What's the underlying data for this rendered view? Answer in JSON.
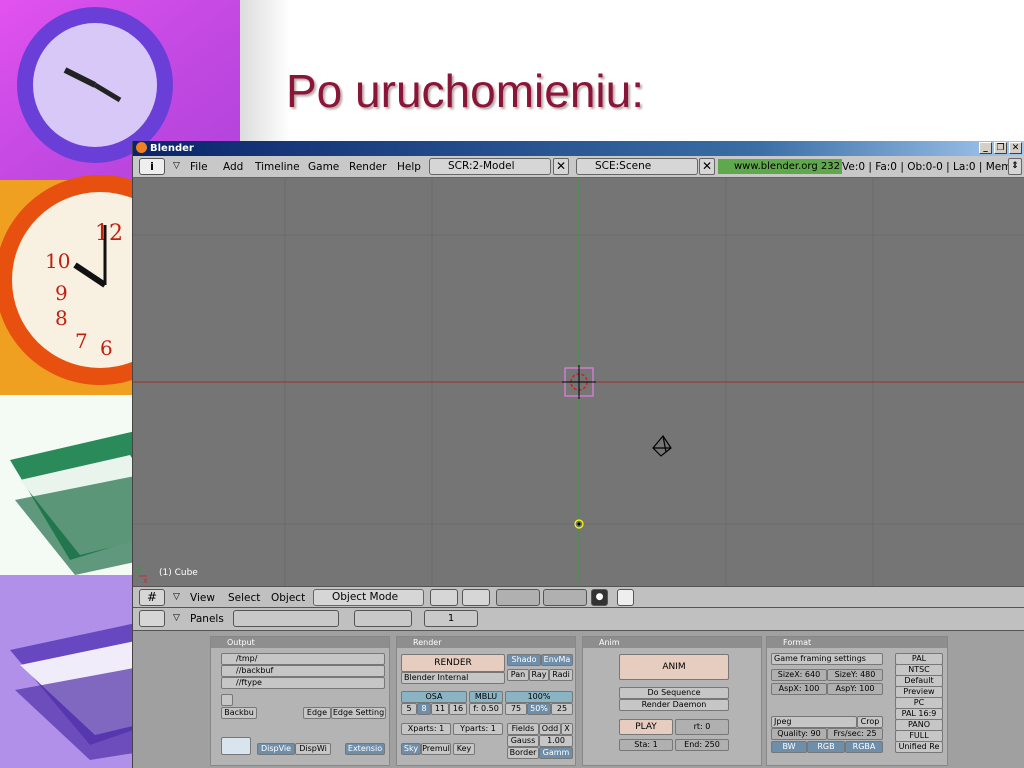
{
  "slide": {
    "title": "Po uruchomieniu:"
  },
  "window": {
    "title": "Blender",
    "minimize": "_",
    "maximize": "❐",
    "close": "✕"
  },
  "menubar": {
    "info": "i",
    "menus": [
      "File",
      "Add",
      "Timeline",
      "Game",
      "Render",
      "Help"
    ],
    "screen": "SCR:2-Model",
    "scene": "SCE:Scene",
    "url": "www.blender.org 232",
    "stats": "Ve:0 | Fa:0 | Ob:0-0 | La:0 | Mem"
  },
  "viewport": {
    "object_label": "(1) Cube"
  },
  "view3d_header": {
    "menus": [
      "View",
      "Select",
      "Object"
    ],
    "mode": "Object Mode"
  },
  "buttons_header": {
    "panels_label": "Panels",
    "frame": "1"
  },
  "panels": {
    "output": {
      "title": "Output",
      "paths": [
        "/tmp/",
        "//backbuf",
        "//ftype"
      ],
      "backbuf": "Backbu",
      "edge": "Edge",
      "edge_setting": "Edge Setting",
      "dispview": "DispVie",
      "dispwin": "DispWi",
      "extensions": "Extensio"
    },
    "render": {
      "title": "Render",
      "render_btn": "RENDER",
      "engine": "Blender Internal",
      "shadow": "Shado",
      "envmap": "EnvMa",
      "pano": "Pan",
      "ray": "Ray",
      "radio": "Radi",
      "osa": "OSA",
      "mblur": "MBLU",
      "percent100": "100%",
      "osa_vals": [
        "5",
        "8",
        "11",
        "16"
      ],
      "bf": "f: 0.50",
      "pct_vals": [
        "75",
        "50%",
        "25"
      ],
      "xparts": "Xparts: 1",
      "yparts": "Yparts: 1",
      "fields": "Fields",
      "odd": "Odd",
      "x": "X",
      "gauss": "Gauss",
      "gauss_val": "1.00",
      "sky": "Sky",
      "premul": "Premul",
      "key": "Key",
      "border": "Border",
      "gamma": "Gamm"
    },
    "anim": {
      "title": "Anim",
      "anim_btn": "ANIM",
      "do_sequence": "Do Sequence",
      "render_daemon": "Render Daemon",
      "play": "PLAY",
      "rt": "rt: 0",
      "sta": "Sta: 1",
      "end": "End: 250"
    },
    "format": {
      "title": "Format",
      "game_framing": "Game framing settings",
      "sizex": "SizeX: 640",
      "sizey": "SizeY: 480",
      "aspx": "AspX: 100",
      "aspy": "AspY: 100",
      "filetype": "Jpeg",
      "crop": "Crop",
      "quality": "Quality: 90",
      "fps": "Frs/sec: 25",
      "bw": "BW",
      "rgb": "RGB",
      "rgba": "RGBA",
      "presets": [
        "PAL",
        "NTSC",
        "Default",
        "Preview",
        "PC",
        "PAL 16:9",
        "PANO",
        "FULL",
        "Unified Re"
      ]
    }
  }
}
